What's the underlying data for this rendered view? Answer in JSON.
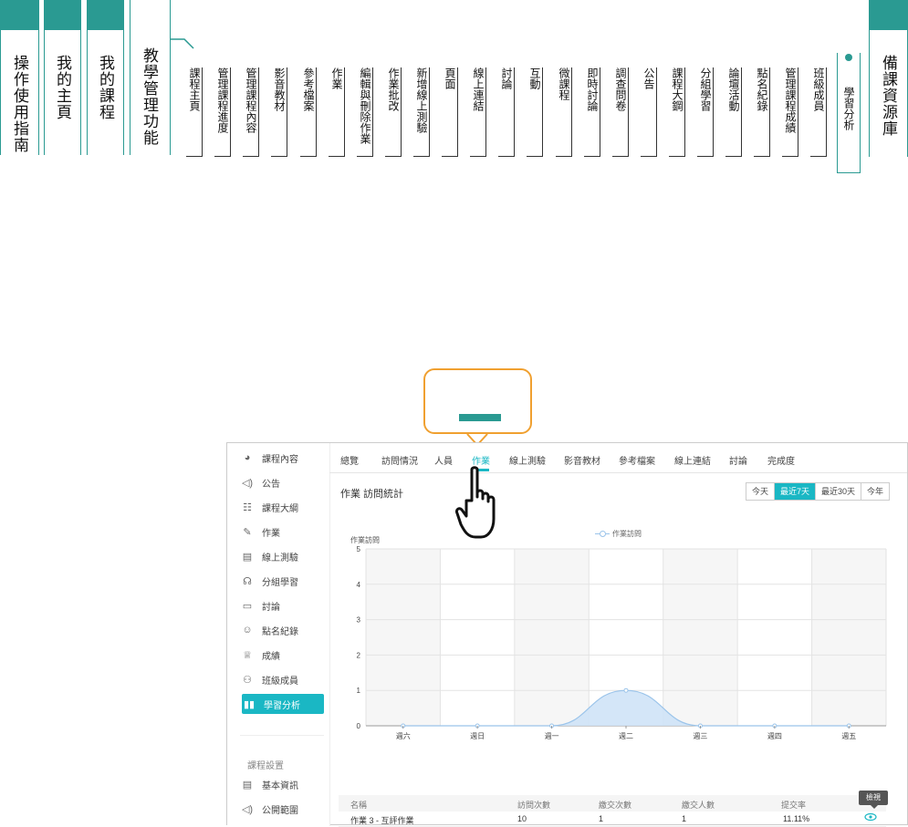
{
  "topnav": {
    "main_tabs": [
      "操作使用指南",
      "我的主頁",
      "我的課程",
      "教學管理功能"
    ],
    "sub_items": [
      "課程主頁",
      "管理課程進度",
      "管理課程內容",
      "影音教材",
      "參考檔案",
      "作業",
      "編輯與刪除作業",
      "作業批改",
      "新增線上測驗",
      "頁面",
      "線上連結",
      "討論",
      "互動",
      "微課程",
      "即時討論",
      "調查問卷",
      "公告",
      "課程大鋼",
      "分組學習",
      "論壇活動",
      "點名紀錄",
      "管理課程成績",
      "班級成員",
      "學習分析"
    ],
    "right_tab": "備課資源庫",
    "accent": "#2a9a92"
  },
  "sidebar": {
    "items": [
      {
        "label": "課程內容",
        "icon": "course-content-icon"
      },
      {
        "label": "公告",
        "icon": "speaker-icon"
      },
      {
        "label": "課程大綱",
        "icon": "outline-icon"
      },
      {
        "label": "作業",
        "icon": "assignment-icon"
      },
      {
        "label": "線上測驗",
        "icon": "quiz-icon"
      },
      {
        "label": "分組學習",
        "icon": "group-icon"
      },
      {
        "label": "討論",
        "icon": "chat-icon"
      },
      {
        "label": "點名紀錄",
        "icon": "rollcall-icon"
      },
      {
        "label": "成績",
        "icon": "trophy-icon"
      },
      {
        "label": "班級成員",
        "icon": "members-icon"
      },
      {
        "label": "學習分析",
        "icon": "analytics-icon"
      }
    ],
    "settings_title": "課程設置",
    "settings_items": [
      {
        "label": "基本資訊",
        "icon": "info-icon"
      },
      {
        "label": "公開範圍",
        "icon": "broadcast-icon"
      }
    ],
    "accent": "#1ab7c4"
  },
  "tabs": [
    "總覽",
    "訪問情況",
    "人員",
    "作業",
    "線上測驗",
    "影音教材",
    "參考檔案",
    "線上連結",
    "討論",
    "完成度"
  ],
  "page_title": "作業 訪問統計",
  "range_buttons": [
    "今天",
    "最近7天",
    "最近30天",
    "今年"
  ],
  "chart_data": {
    "type": "area",
    "legend": [
      "作業訪問"
    ],
    "ylabel": "作業訪問",
    "yticks": [
      "0",
      "1",
      "2",
      "3",
      "4",
      "5"
    ],
    "ylim": [
      0,
      5
    ],
    "categories": [
      "週六",
      "週日",
      "週一",
      "週二",
      "週三",
      "週四",
      "週五"
    ],
    "series": [
      {
        "name": "作業訪問",
        "values": [
          0,
          0,
          0,
          1,
          0,
          0,
          0
        ]
      }
    ],
    "grid": true,
    "color": "#9bc4ea"
  },
  "table": {
    "headers": [
      "名稱",
      "訪問次數",
      "繳交次數",
      "繳交人數",
      "提交率"
    ],
    "rows": [
      [
        "作業 3 - 互評作業",
        "10",
        "1",
        "1",
        "11.11%"
      ]
    ],
    "tooltip": "檢視"
  }
}
